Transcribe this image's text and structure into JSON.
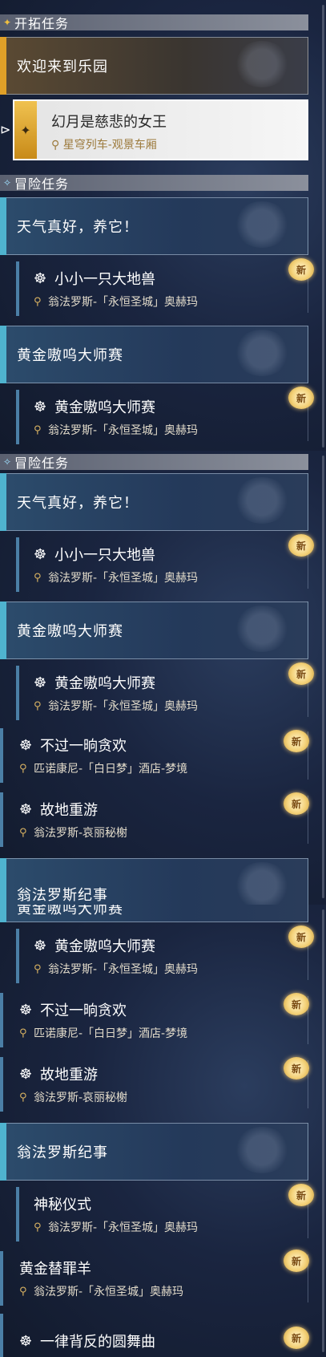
{
  "section_trailblaze": {
    "title": "开拓任务"
  },
  "section_adventure": {
    "title": "冒险任务"
  },
  "trailblaze_card": {
    "title": "欢迎来到乐园"
  },
  "selected_mission": {
    "title": "幻月是慈悲的女王",
    "location": "星穹列车-观景车厢"
  },
  "badge_new": "新",
  "cards": {
    "weather": "天气真好，养它！",
    "golden": "黄金嗷呜大师赛",
    "chronicle": "翁法罗斯纪事"
  },
  "missions": {
    "little_beast": {
      "title": "小小一只大地兽",
      "location": "翁法罗斯-「永恒圣城」奥赫玛"
    },
    "golden_cup": {
      "title": "黄金嗷呜大师赛",
      "location": "翁法罗斯-「永恒圣城」奥赫玛"
    },
    "indulge": {
      "title": "不过一晌贪欢",
      "location": "匹诺康尼-「白日梦」酒店-梦境"
    },
    "revisit": {
      "title": "故地重游",
      "location": "翁法罗斯-哀丽秘榭"
    },
    "ritual": {
      "title": "神秘仪式",
      "location": "翁法罗斯-「永恒圣城」奥赫玛"
    },
    "scapegoat": {
      "title": "黄金替罪羊",
      "location": "翁法罗斯-「永恒圣城」奥赫玛"
    },
    "dance": {
      "title": "一律背反的圆舞曲"
    }
  }
}
